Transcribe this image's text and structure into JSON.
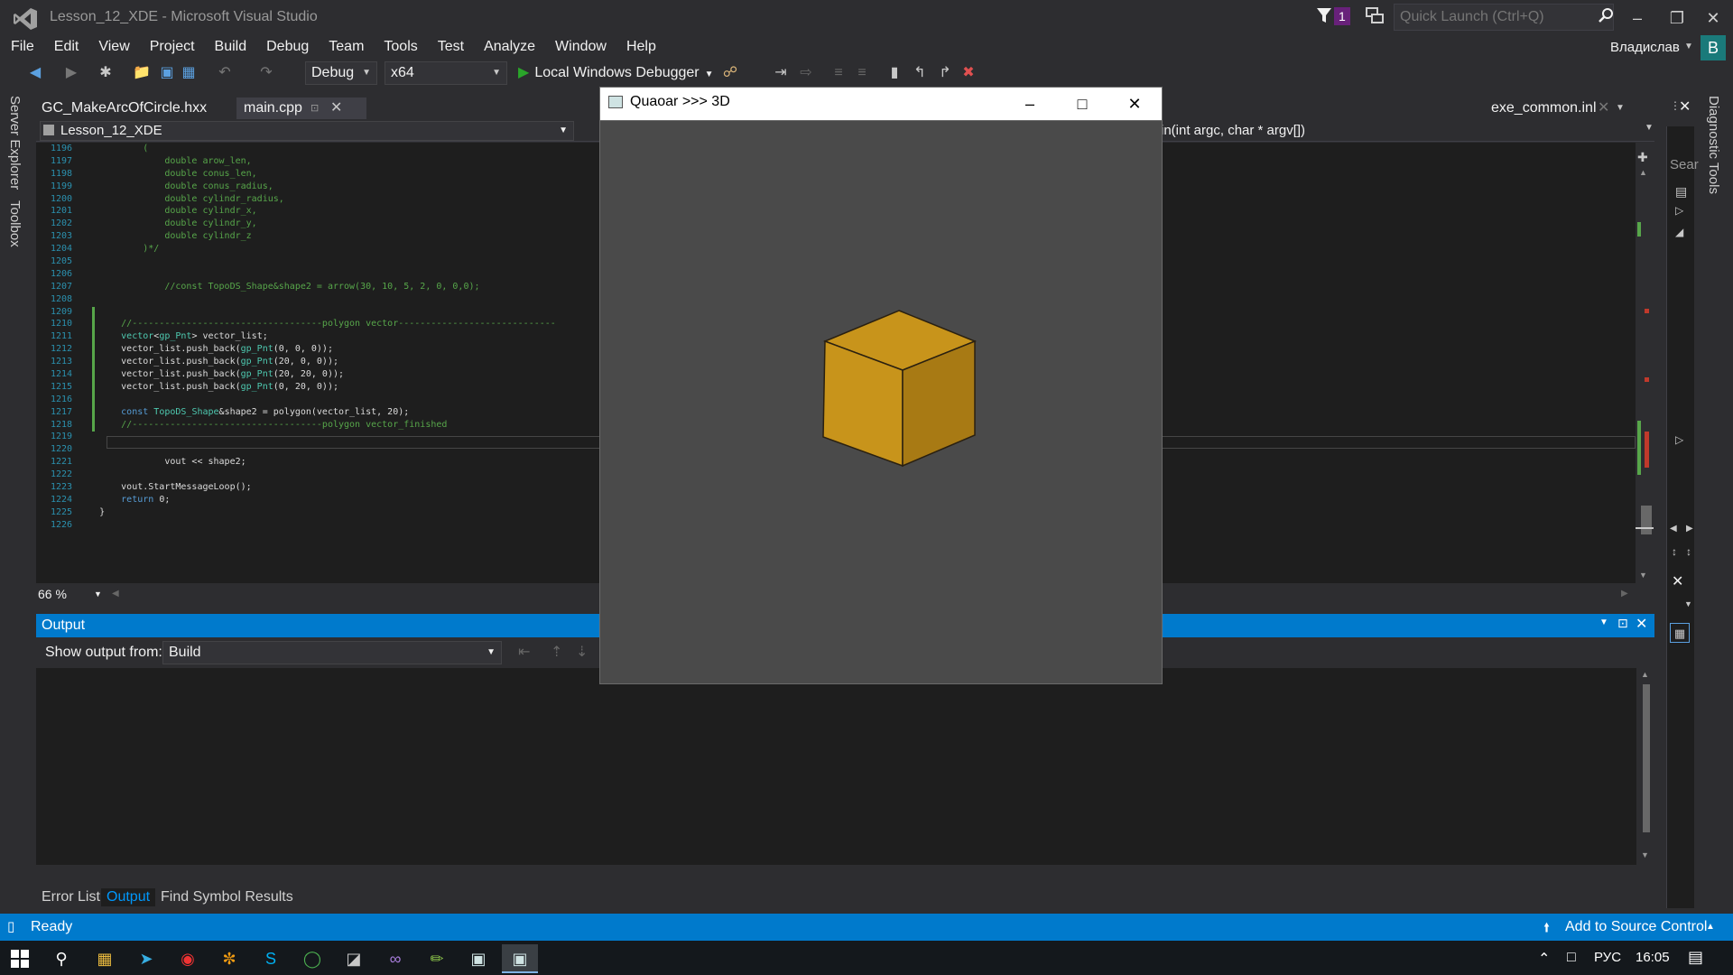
{
  "window": {
    "title": "Lesson_12_XDE - Microsoft Visual Studio",
    "notification_count": "1",
    "quick_launch_placeholder": "Quick Launch (Ctrl+Q)"
  },
  "menu": [
    "File",
    "Edit",
    "View",
    "Project",
    "Build",
    "Debug",
    "Team",
    "Tools",
    "Test",
    "Analyze",
    "Window",
    "Help"
  ],
  "user": {
    "name": "Владислав",
    "initial": "В"
  },
  "toolbar": {
    "configuration": "Debug",
    "platform": "x64",
    "debugger_label": "Local Windows Debugger"
  },
  "left_rail": [
    "Server Explorer",
    "Toolbox"
  ],
  "right_rail": {
    "label": "Diagnostic Tools",
    "search_placeholder": "Sear"
  },
  "tabs": [
    {
      "label": "GC_MakeArcOfCircle.hxx",
      "active": false
    },
    {
      "label": "main.cpp",
      "active": true
    },
    {
      "label": "exe_common.inl",
      "active": false
    }
  ],
  "nav": {
    "project": "Lesson_12_XDE",
    "member": "in(int argc, char * argv[])"
  },
  "code_lines": [
    {
      "n": "1196",
      "segs": [
        [
          "comment",
          "            ("
        ]
      ]
    },
    {
      "n": "1197",
      "segs": [
        [
          "comment",
          "                double arow_len,"
        ]
      ]
    },
    {
      "n": "1198",
      "segs": [
        [
          "comment",
          "                double conus_len,"
        ]
      ]
    },
    {
      "n": "1199",
      "segs": [
        [
          "comment",
          "                double conus_radius,"
        ]
      ]
    },
    {
      "n": "1200",
      "segs": [
        [
          "comment",
          "                double cylindr_radius,"
        ]
      ]
    },
    {
      "n": "1201",
      "segs": [
        [
          "comment",
          "                double cylindr_x,"
        ]
      ]
    },
    {
      "n": "1202",
      "segs": [
        [
          "comment",
          "                double cylindr_y,"
        ]
      ]
    },
    {
      "n": "1203",
      "segs": [
        [
          "comment",
          "                double cylindr_z"
        ]
      ]
    },
    {
      "n": "1204",
      "segs": [
        [
          "comment",
          "            )*/"
        ]
      ]
    },
    {
      "n": "1205",
      "segs": []
    },
    {
      "n": "1206",
      "segs": []
    },
    {
      "n": "1207",
      "segs": [
        [
          "comment",
          "                //const TopoDS_Shape&shape2 = arrow(30, 10, 5, 2, 0, 0,0);"
        ]
      ]
    },
    {
      "n": "1208",
      "segs": []
    },
    {
      "n": "1209",
      "segs": []
    },
    {
      "n": "1210",
      "segs": [
        [
          "comment",
          "        //-----------------------------------polygon vector-----------------------------"
        ]
      ]
    },
    {
      "n": "1211",
      "segs": [
        [
          "type",
          "        vector"
        ],
        [
          "text",
          "<"
        ],
        [
          "type",
          "gp_Pnt"
        ],
        [
          "text",
          "> vector_list;"
        ]
      ]
    },
    {
      "n": "1212",
      "segs": [
        [
          "text",
          "        vector_list.push_back("
        ],
        [
          "type",
          "gp_Pnt"
        ],
        [
          "text",
          "(0, 0, 0));"
        ]
      ]
    },
    {
      "n": "1213",
      "segs": [
        [
          "text",
          "        vector_list.push_back("
        ],
        [
          "type",
          "gp_Pnt"
        ],
        [
          "text",
          "(20, 0, 0));"
        ]
      ]
    },
    {
      "n": "1214",
      "segs": [
        [
          "text",
          "        vector_list.push_back("
        ],
        [
          "type",
          "gp_Pnt"
        ],
        [
          "text",
          "(20, 20, 0));"
        ]
      ]
    },
    {
      "n": "1215",
      "segs": [
        [
          "text",
          "        vector_list.push_back("
        ],
        [
          "type",
          "gp_Pnt"
        ],
        [
          "text",
          "(0, 20, 0));"
        ]
      ]
    },
    {
      "n": "1216",
      "segs": []
    },
    {
      "n": "1217",
      "segs": [
        [
          "kw",
          "        const "
        ],
        [
          "type",
          "TopoDS_Shape"
        ],
        [
          "text",
          "&shape2 = polygon(vector_list, 20);"
        ]
      ]
    },
    {
      "n": "1218",
      "segs": [
        [
          "comment",
          "        //-----------------------------------polygon vector_finished"
        ]
      ]
    },
    {
      "n": "1219",
      "segs": []
    },
    {
      "n": "1220",
      "segs": []
    },
    {
      "n": "1221",
      "segs": [
        [
          "text",
          "                vout << shape2;"
        ]
      ]
    },
    {
      "n": "1222",
      "segs": []
    },
    {
      "n": "1223",
      "segs": [
        [
          "text",
          "        vout.StartMessageLoop();"
        ]
      ]
    },
    {
      "n": "1224",
      "segs": [
        [
          "kw",
          "        return "
        ],
        [
          "text",
          "0;"
        ]
      ]
    },
    {
      "n": "1225",
      "segs": [
        [
          "text",
          "    }"
        ]
      ]
    },
    {
      "n": "1226",
      "segs": []
    }
  ],
  "editor": {
    "zoom": "66 %"
  },
  "output": {
    "title": "Output",
    "show_from_label": "Show output from:",
    "source": "Build"
  },
  "bottom_tabs": [
    "Error List",
    "Output",
    "Find Symbol Results"
  ],
  "status": {
    "text": "Ready",
    "source_control": "Add to Source Control"
  },
  "viewer": {
    "title": "Quaoar >>> 3D",
    "cube_color": "#c8941b"
  },
  "taskbar": {
    "language": "РУС",
    "time": "16:05"
  }
}
